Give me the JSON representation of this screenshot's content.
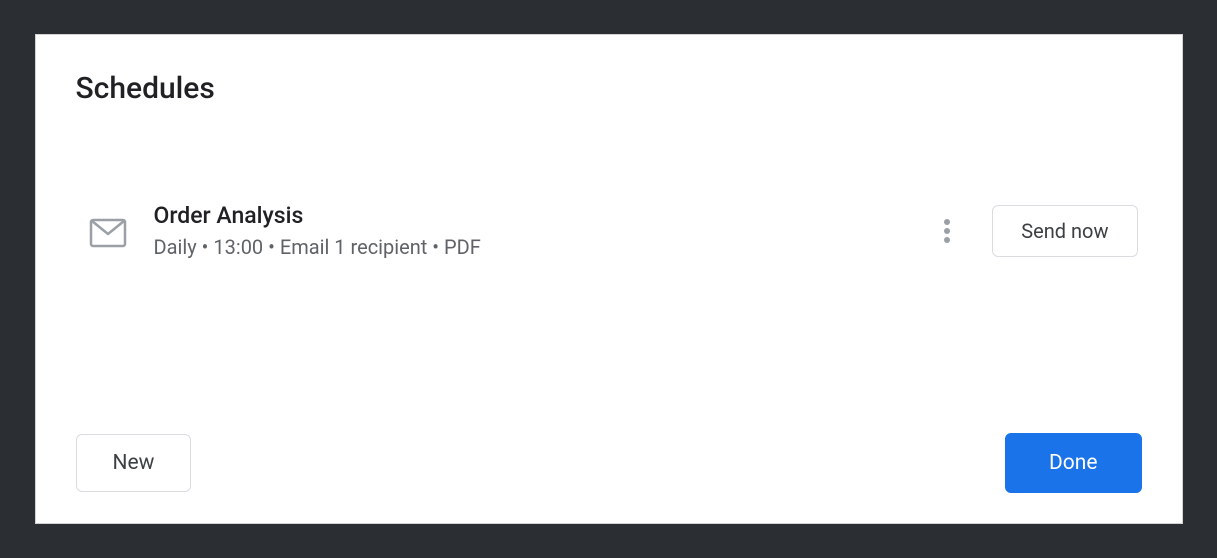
{
  "dialog": {
    "title": "Schedules"
  },
  "schedules": [
    {
      "icon": "mail-icon",
      "name": "Order Analysis",
      "details": "Daily • 13:00 • Email 1 recipient • PDF",
      "send_now_label": "Send now"
    }
  ],
  "footer": {
    "new_label": "New",
    "done_label": "Done"
  }
}
